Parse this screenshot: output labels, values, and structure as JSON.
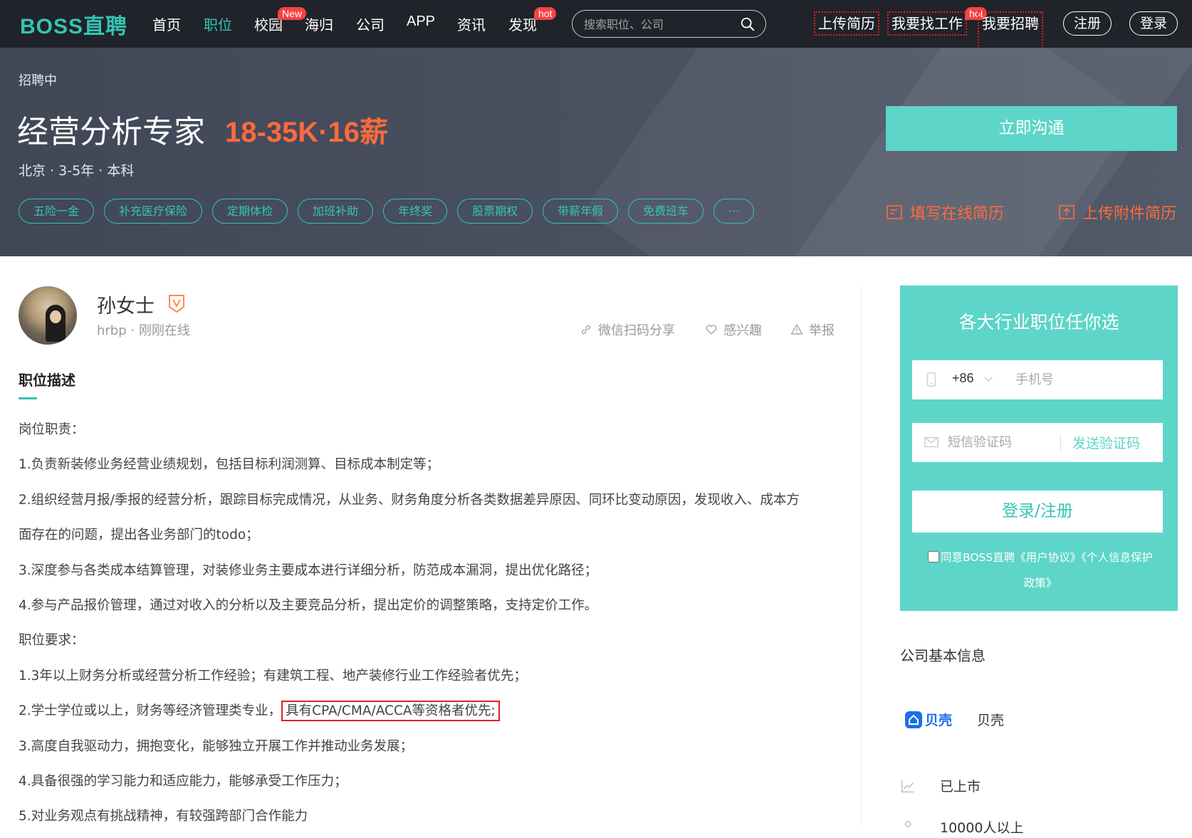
{
  "nav": {
    "logo": "BOSS直聘",
    "items": [
      {
        "label": "首页"
      },
      {
        "label": "职位"
      },
      {
        "label": "校园",
        "badge": "New"
      },
      {
        "label": "海归"
      },
      {
        "label": "公司"
      },
      {
        "label": "APP"
      },
      {
        "label": "资讯"
      },
      {
        "label": "发现",
        "badge": "hot"
      }
    ],
    "search_placeholder": "搜索职位、公司",
    "upload_resume": "上传简历",
    "find_job": "我要找工作",
    "find_job_badge": "hot",
    "recruit": "我要招聘",
    "register": "注册",
    "login": "登录"
  },
  "job": {
    "status": "招聘中",
    "title": "经营分析专家",
    "salary": "18-35K·16薪",
    "meta": "北京 · 3-5年 · 本科",
    "tags": [
      "五险一金",
      "补充医疗保险",
      "定期体检",
      "加班补助",
      "年终奖",
      "股票期权",
      "带薪年假",
      "免费班车",
      "···"
    ],
    "chat_button": "立即沟通",
    "fill_resume": "填写在线简历",
    "upload_attachment": "上传附件简历"
  },
  "recruiter": {
    "name": "孙女士",
    "meta": "hrbp · 刚刚在线",
    "share": "微信扫码分享",
    "interested": "感兴趣",
    "report": "举报"
  },
  "description": {
    "title": "职位描述",
    "lines": [
      "岗位职责：",
      "1.负责新装修业务经营业绩规划，包括目标利润测算、目标成本制定等；",
      "2.组织经营月报/季报的经营分析，跟踪目标完成情况，从业务、财务角度分析各类数据差异原因、同环比变动原因，发现收入、成本方",
      "面存在的问题，提出各业务部门的todo；",
      "3.深度参与各类成本结算管理，对装修业务主要成本进行详细分析，防范成本漏洞，提出优化路径；",
      "4.参与产品报价管理，通过对收入的分析以及主要竞品分析，提出定价的调整策略，支持定价工作。",
      "职位要求：",
      "1.3年以上财务分析或经营分析工作经验；有建筑工程、地产装修行业工作经验者优先；",
      "2.学士学位或以上，财务等经济管理类专业，",
      "3.高度自我驱动力，拥抱变化，能够独立开展工作并推动业务发展；",
      "4.具备很强的学习能力和适应能力，能够承受工作压力；",
      "5.对业务观点有挑战精神，有较强跨部门合作能力"
    ],
    "highlight": "具有CPA/CMA/ACCA等资格者优先;"
  },
  "login_card": {
    "title": "各大行业职位任你选",
    "country_code": "+86",
    "phone_placeholder": "手机号",
    "code_placeholder": "短信验证码",
    "send_code": "发送验证码",
    "submit": "登录/注册",
    "agree_line1": "同意BOSS直聘《用户协议》《个人信息保护",
    "agree_line2": "政策》"
  },
  "company": {
    "section_title": "公司基本信息",
    "logo_text": "贝壳",
    "name": "贝壳",
    "stage": "已上市",
    "size": "10000人以上"
  },
  "colors": {
    "accent": "#35c4b4",
    "salary": "#ff6a3d",
    "nav_bg": "#202329",
    "card": "#5dd5c8",
    "highlight_border": "#e02020"
  },
  "icons": [
    "search-icon",
    "verified-icon",
    "link-icon",
    "heart-icon",
    "warning-icon",
    "resume-edit-icon",
    "upload-icon",
    "phone-icon",
    "chevron-down-icon",
    "mail-icon",
    "chart-icon",
    "people-icon"
  ]
}
